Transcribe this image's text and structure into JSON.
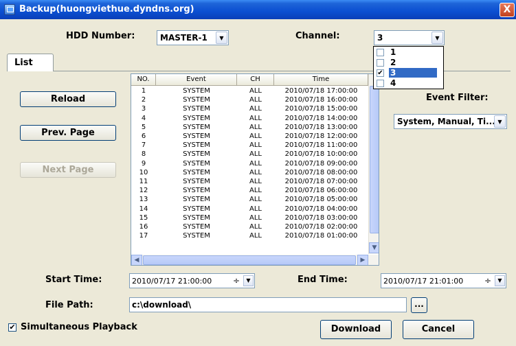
{
  "window": {
    "title": "Backup(huongviethue.dyndns.org)",
    "close_glyph": "X"
  },
  "hdd": {
    "label": "HDD Number:",
    "value": "MASTER-1"
  },
  "channel": {
    "label": "Channel:",
    "value": "3",
    "options": [
      {
        "label": "1",
        "checked": false
      },
      {
        "label": "2",
        "checked": false
      },
      {
        "label": "3",
        "checked": true
      },
      {
        "label": "4",
        "checked": false
      }
    ]
  },
  "tabs": [
    {
      "label": "List"
    }
  ],
  "buttons": {
    "reload": "Reload",
    "prev_page": "Prev. Page",
    "next_page": "Next Page",
    "download": "Download",
    "cancel": "Cancel",
    "browse": "..."
  },
  "event_filter": {
    "label": "Event Filter:",
    "value": "System, Manual, Ti..."
  },
  "table": {
    "columns": [
      "NO.",
      "Event",
      "CH",
      "Time"
    ],
    "rows": [
      [
        "1",
        "SYSTEM",
        "ALL",
        "2010/07/18 17:00:00"
      ],
      [
        "2",
        "SYSTEM",
        "ALL",
        "2010/07/18 16:00:00"
      ],
      [
        "3",
        "SYSTEM",
        "ALL",
        "2010/07/18 15:00:00"
      ],
      [
        "4",
        "SYSTEM",
        "ALL",
        "2010/07/18 14:00:00"
      ],
      [
        "5",
        "SYSTEM",
        "ALL",
        "2010/07/18 13:00:00"
      ],
      [
        "6",
        "SYSTEM",
        "ALL",
        "2010/07/18 12:00:00"
      ],
      [
        "7",
        "SYSTEM",
        "ALL",
        "2010/07/18 11:00:00"
      ],
      [
        "8",
        "SYSTEM",
        "ALL",
        "2010/07/18 10:00:00"
      ],
      [
        "9",
        "SYSTEM",
        "ALL",
        "2010/07/18 09:00:00"
      ],
      [
        "10",
        "SYSTEM",
        "ALL",
        "2010/07/18 08:00:00"
      ],
      [
        "11",
        "SYSTEM",
        "ALL",
        "2010/07/18 07:00:00"
      ],
      [
        "12",
        "SYSTEM",
        "ALL",
        "2010/07/18 06:00:00"
      ],
      [
        "13",
        "SYSTEM",
        "ALL",
        "2010/07/18 05:00:00"
      ],
      [
        "14",
        "SYSTEM",
        "ALL",
        "2010/07/18 04:00:00"
      ],
      [
        "15",
        "SYSTEM",
        "ALL",
        "2010/07/18 03:00:00"
      ],
      [
        "16",
        "SYSTEM",
        "ALL",
        "2010/07/18 02:00:00"
      ],
      [
        "17",
        "SYSTEM",
        "ALL",
        "2010/07/18 01:00:00"
      ]
    ]
  },
  "start_time": {
    "label": "Start Time:",
    "value": "2010/07/17 21:00:00"
  },
  "end_time": {
    "label": "End Time:",
    "value": "2010/07/17 21:01:00"
  },
  "file_path": {
    "label": "File Path:",
    "value": "c:\\download\\"
  },
  "simultaneous": {
    "label": "Simultaneous Playback",
    "checked": true
  },
  "colors": {
    "titlebar": "#0b4fd1",
    "selection": "#316ac5",
    "face": "#ece9d8"
  }
}
